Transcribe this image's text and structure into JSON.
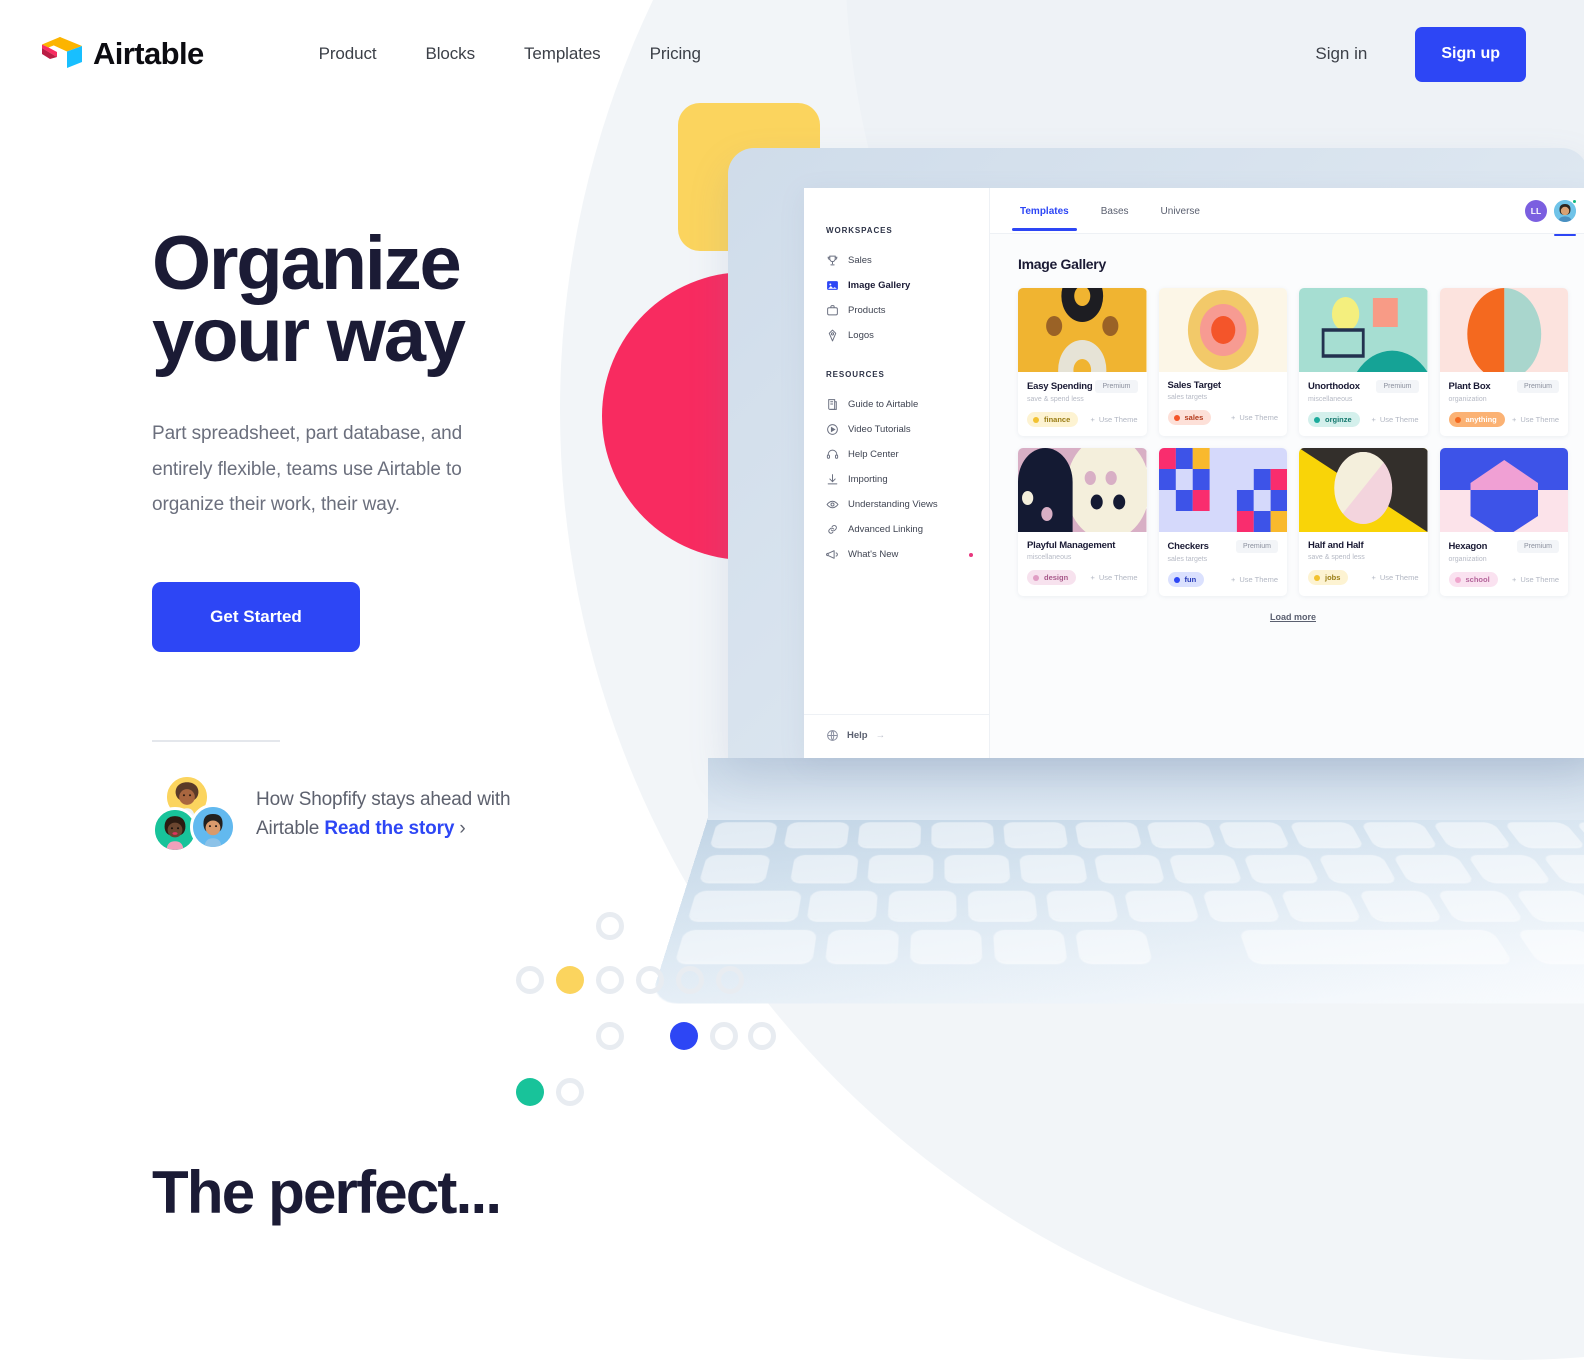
{
  "brand": {
    "name": "Airtable",
    "accent": "#2d46f5",
    "ink": "#1b1b35"
  },
  "header": {
    "nav": [
      {
        "label": "Product"
      },
      {
        "label": "Blocks"
      },
      {
        "label": "Templates"
      },
      {
        "label": "Pricing"
      }
    ],
    "sign_in": "Sign in",
    "sign_up": "Sign up"
  },
  "hero": {
    "title_line1": "Organize",
    "title_line2": "your way",
    "subtitle": "Part spreadsheet, part database, and entirely flexible, teams use Airtable to organize their work, their way.",
    "cta": "Get Started",
    "testimonial": {
      "text_before": "How Shopfify stays ahead with Airtable ",
      "link": "Read the story",
      "chevron": "›"
    }
  },
  "app": {
    "sidebar": {
      "workspaces_header": "WORKSPACES",
      "workspaces": [
        {
          "label": "Sales",
          "icon": "trophy-icon",
          "active": false
        },
        {
          "label": "Image Gallery",
          "icon": "image-icon",
          "active": true
        },
        {
          "label": "Products",
          "icon": "briefcase-icon",
          "active": false
        },
        {
          "label": "Logos",
          "icon": "pen-icon",
          "active": false
        }
      ],
      "resources_header": "RESOURCES",
      "resources": [
        {
          "label": "Guide to Airtable",
          "icon": "book-icon"
        },
        {
          "label": "Video Tutorials",
          "icon": "play-circle-icon"
        },
        {
          "label": "Help Center",
          "icon": "headset-icon"
        },
        {
          "label": "Importing",
          "icon": "download-icon"
        },
        {
          "label": "Understanding Views",
          "icon": "eye-icon"
        },
        {
          "label": "Advanced Linking",
          "icon": "link-icon"
        },
        {
          "label": "What's New",
          "icon": "megaphone-icon",
          "badge": true
        }
      ],
      "help": "Help",
      "help_arrow": "→"
    },
    "topbar": {
      "tabs": [
        {
          "label": "Templates",
          "active": true
        },
        {
          "label": "Bases",
          "active": false
        },
        {
          "label": "Universe",
          "active": false
        }
      ],
      "avatar_initials": "LL"
    },
    "gallery_title": "Image Gallery",
    "load_more": "Load more",
    "use_theme_label": "Use Theme",
    "premium_label": "Premium",
    "cards": [
      {
        "name": "Easy Spending",
        "subtitle": "save & spend less",
        "premium": true,
        "tag": "finance",
        "tag_color": "#f2c230",
        "tag_bg": "#fdf3d2",
        "tag_text": "#9a7d15",
        "art": "easy-spending"
      },
      {
        "name": "Sales Target",
        "subtitle": "sales targets",
        "premium": false,
        "tag": "sales",
        "tag_color": "#f4552a",
        "tag_bg": "#fde0d8",
        "tag_text": "#b3381a",
        "art": "sales-target"
      },
      {
        "name": "Unorthodox",
        "subtitle": "miscellaneous",
        "premium": true,
        "tag": "orginze",
        "tag_color": "#1aab9b",
        "tag_bg": "#d4f0ec",
        "tag_text": "#12776c",
        "art": "unorthodox"
      },
      {
        "name": "Plant Box",
        "subtitle": "organization",
        "premium": true,
        "tag": "anything",
        "tag_color": "#f4691f",
        "tag_bg": "#fbb274",
        "tag_text": "#fff",
        "art": "plant-box"
      },
      {
        "name": "Playful Management",
        "subtitle": "miscellaneous",
        "premium": false,
        "tag": "design",
        "tag_color": "#e09ec4",
        "tag_bg": "#f7e2ee",
        "tag_text": "#a8598a",
        "art": "playful-management"
      },
      {
        "name": "Checkers",
        "subtitle": "sales targets",
        "premium": true,
        "tag": "fun",
        "tag_color": "#2d46f5",
        "tag_bg": "#dbe1fe",
        "tag_text": "#2539b8",
        "art": "checkers"
      },
      {
        "name": "Half and Half",
        "subtitle": "save & spend less",
        "premium": false,
        "tag": "jobs",
        "tag_color": "#f2c230",
        "tag_bg": "#fdf3d2",
        "tag_text": "#9a7d15",
        "art": "half-and-half"
      },
      {
        "name": "Hexagon",
        "subtitle": "organization",
        "premium": true,
        "tag": "school",
        "tag_color": "#efa6cd",
        "tag_bg": "#fae2f0",
        "tag_text": "#b4649a",
        "art": "hexagon"
      }
    ]
  },
  "bottom": {
    "heading": "The perfect..."
  }
}
